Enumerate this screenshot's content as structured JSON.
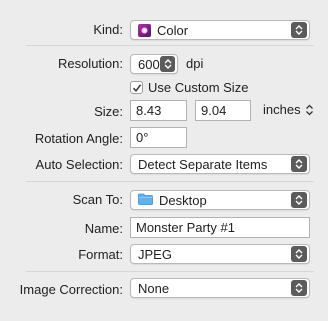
{
  "kind": {
    "label": "Kind:",
    "value": "Color",
    "icon": "color-swatch-icon"
  },
  "resolution": {
    "label": "Resolution:",
    "value": "600",
    "unit": "dpi"
  },
  "custom_size": {
    "label": "Use Custom Size",
    "checked": true
  },
  "size": {
    "label": "Size:",
    "width": "8.43",
    "height": "9.04",
    "unit": "inches"
  },
  "rotation": {
    "label": "Rotation Angle:",
    "value": "0°"
  },
  "auto_selection": {
    "label": "Auto Selection:",
    "value": "Detect Separate Items"
  },
  "scan_to": {
    "label": "Scan To:",
    "value": "Desktop",
    "icon": "folder-icon"
  },
  "name": {
    "label": "Name:",
    "value": "Monster Party #1"
  },
  "format": {
    "label": "Format:",
    "value": "JPEG"
  },
  "image_correction": {
    "label": "Image Correction:",
    "value": "None"
  },
  "colors": {
    "background": "#ececec",
    "popup_arrows": "#5b5b5b",
    "folder": "#4aa3e8"
  }
}
